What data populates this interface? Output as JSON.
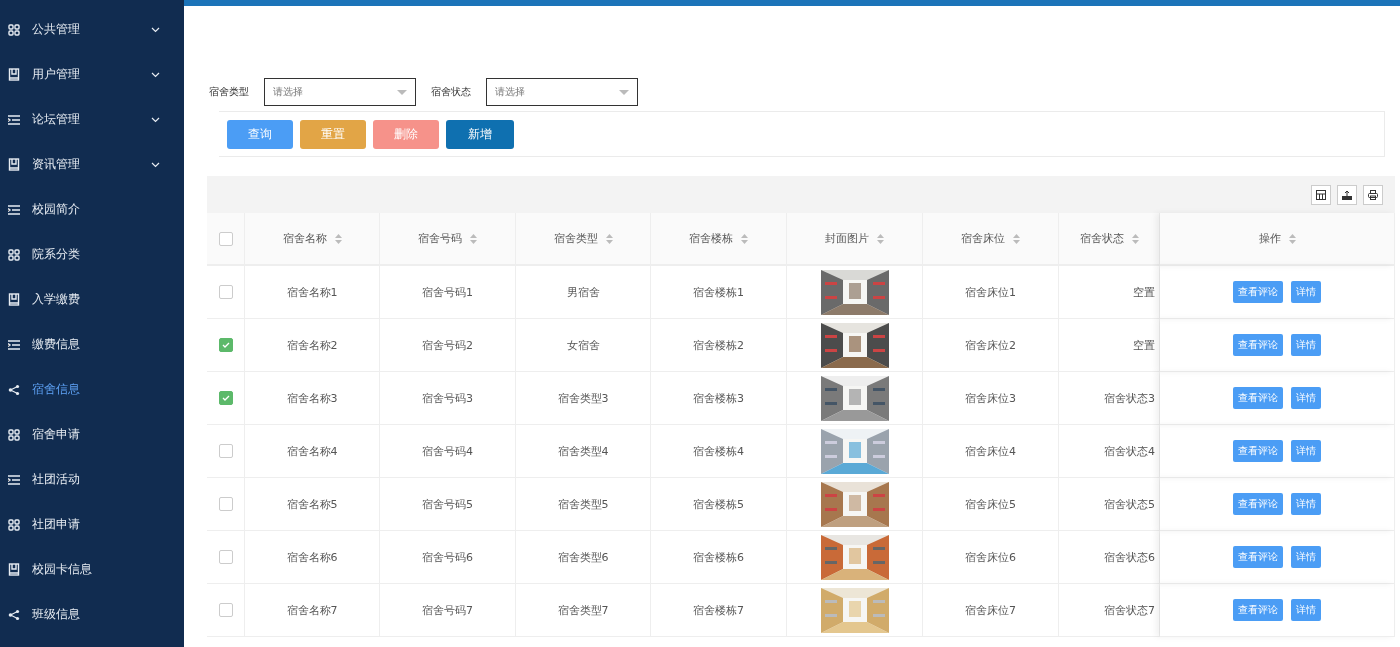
{
  "sidebar": {
    "items": [
      {
        "label": "公共管理",
        "kind": "grid",
        "expandable": true,
        "selected": false
      },
      {
        "label": "用户管理",
        "kind": "book",
        "expandable": true,
        "selected": false
      },
      {
        "label": "论坛管理",
        "kind": "list",
        "expandable": true,
        "selected": false
      },
      {
        "label": "资讯管理",
        "kind": "book",
        "expandable": true,
        "selected": false
      },
      {
        "label": "校园简介",
        "kind": "list",
        "expandable": false,
        "selected": false
      },
      {
        "label": "院系分类",
        "kind": "grid",
        "expandable": false,
        "selected": false
      },
      {
        "label": "入学缴费",
        "kind": "book",
        "expandable": false,
        "selected": false
      },
      {
        "label": "缴费信息",
        "kind": "list",
        "expandable": false,
        "selected": false
      },
      {
        "label": "宿舍信息",
        "kind": "share",
        "expandable": false,
        "selected": true
      },
      {
        "label": "宿舍申请",
        "kind": "grid",
        "expandable": false,
        "selected": false
      },
      {
        "label": "社团活动",
        "kind": "list",
        "expandable": false,
        "selected": false
      },
      {
        "label": "社团申请",
        "kind": "grid",
        "expandable": false,
        "selected": false
      },
      {
        "label": "校园卡信息",
        "kind": "book",
        "expandable": false,
        "selected": false
      },
      {
        "label": "班级信息",
        "kind": "share",
        "expandable": false,
        "selected": false
      }
    ]
  },
  "filters": [
    {
      "label": "宿舍类型",
      "placeholder": "请选择"
    },
    {
      "label": "宿舍状态",
      "placeholder": "请选择"
    }
  ],
  "buttons": [
    {
      "label": "查询",
      "kind": "query"
    },
    {
      "label": "重置",
      "kind": "reset"
    },
    {
      "label": "删除",
      "kind": "delete"
    },
    {
      "label": "新增",
      "kind": "add"
    }
  ],
  "table": {
    "select_all_checked": false,
    "columns": [
      "宿舍名称",
      "宿舍号码",
      "宿舍类型",
      "宿舍楼栋",
      "封面图片",
      "宿舍床位",
      "宿舍状态",
      "操作"
    ],
    "rows": [
      {
        "checked": false,
        "cells": [
          "宿舍名称1",
          "宿舍号码1",
          "男宿舍",
          "宿舍楼栋1",
          "",
          "宿舍床位1",
          "空置"
        ],
        "actions": [
          "查看评论",
          "详情"
        ]
      },
      {
        "checked": true,
        "cells": [
          "宿舍名称2",
          "宿舍号码2",
          "女宿舍",
          "宿舍楼栋2",
          "",
          "宿舍床位2",
          "空置"
        ],
        "actions": [
          "查看评论",
          "详情"
        ]
      },
      {
        "checked": true,
        "cells": [
          "宿舍名称3",
          "宿舍号码3",
          "宿舍类型3",
          "宿舍楼栋3",
          "",
          "宿舍床位3",
          "宿舍状态3"
        ],
        "actions": [
          "查看评论",
          "详情"
        ]
      },
      {
        "checked": false,
        "cells": [
          "宿舍名称4",
          "宿舍号码4",
          "宿舍类型4",
          "宿舍楼栋4",
          "",
          "宿舍床位4",
          "宿舍状态4"
        ],
        "actions": [
          "查看评论",
          "详情"
        ]
      },
      {
        "checked": false,
        "cells": [
          "宿舍名称5",
          "宿舍号码5",
          "宿舍类型5",
          "宿舍楼栋5",
          "",
          "宿舍床位5",
          "宿舍状态5"
        ],
        "actions": [
          "查看评论",
          "详情"
        ]
      },
      {
        "checked": false,
        "cells": [
          "宿舍名称6",
          "宿舍号码6",
          "宿舍类型6",
          "宿舍楼栋6",
          "",
          "宿舍床位6",
          "宿舍状态6"
        ],
        "actions": [
          "查看评论",
          "详情"
        ]
      },
      {
        "checked": false,
        "cells": [
          "宿舍名称7",
          "宿舍号码7",
          "宿舍类型7",
          "宿舍楼栋7",
          "",
          "宿舍床位7",
          "宿舍状态7"
        ],
        "actions": [
          "查看评论",
          "详情"
        ]
      }
    ]
  }
}
